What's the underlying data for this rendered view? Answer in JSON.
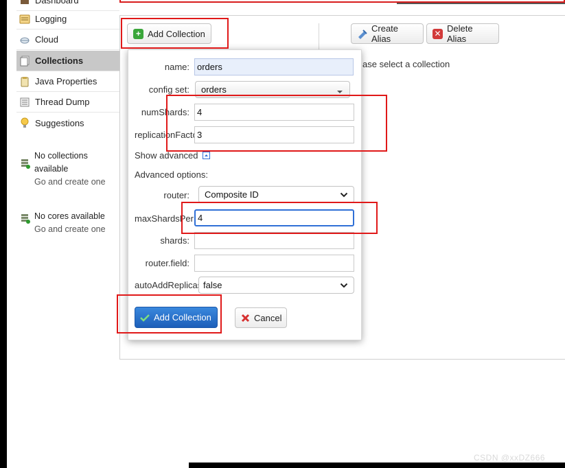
{
  "sidebar": {
    "items": [
      {
        "label": "Dashboard",
        "icon": "dashboard-icon"
      },
      {
        "label": "Logging",
        "icon": "logging-icon"
      },
      {
        "label": "Cloud",
        "icon": "cloud-icon"
      },
      {
        "label": "Collections",
        "icon": "collections-icon",
        "active": true
      },
      {
        "label": "Java Properties",
        "icon": "java-icon"
      },
      {
        "label": "Thread Dump",
        "icon": "thread-dump-icon"
      },
      {
        "label": "Suggestions",
        "icon": "lightbulb-icon"
      }
    ],
    "no_collections": {
      "line1": "No collections",
      "line2": "available",
      "link": "Go and create one"
    },
    "no_cores": {
      "line1": "No cores available",
      "link": "Go and create one"
    }
  },
  "toolbar": {
    "add_collection_label": "Add Collection",
    "create_alias_label": "Create Alias",
    "delete_alias_label": "Delete Alias"
  },
  "hint_text": "ase select a collection",
  "dialog": {
    "name_label": "name:",
    "name_value": "orders",
    "config_set_label": "config set:",
    "config_set_value": "orders",
    "num_shards_label": "numShards:",
    "num_shards_value": "4",
    "replication_label": "replicationFactor:",
    "replication_value": "3",
    "show_advanced_label": "Show advanced",
    "advanced_options_label": "Advanced options:",
    "router_label": "router:",
    "router_value": "Composite ID",
    "max_shards_label": "maxShardsPerNode:",
    "max_shards_value": "4",
    "shards_label": "shards:",
    "shards_value": "",
    "router_field_label": "router.field:",
    "router_field_value": "",
    "auto_add_label": "autoAddReplicas:",
    "auto_add_value": "false",
    "submit_label": "Add Collection",
    "cancel_label": "Cancel"
  },
  "watermark": "CSDN @xxDZ666",
  "colors": {
    "highlight_red": "#e01818",
    "primary_blue": "#2a74cf",
    "active_sidebar": "#c8c8c8"
  }
}
